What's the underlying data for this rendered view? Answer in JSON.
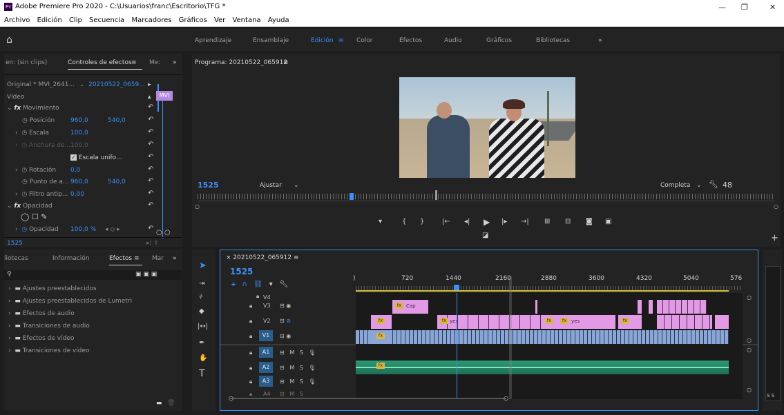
{
  "window": {
    "title": "Adobe Premiere Pro 2020 - C:\\Usuarios\\franc\\Escritorio\\TFG *",
    "app_icon": "Pr"
  },
  "menu": [
    "Archivo",
    "Edición",
    "Clip",
    "Secuencia",
    "Marcadores",
    "Gráficos",
    "Ver",
    "Ventana",
    "Ayuda"
  ],
  "workspaces": {
    "items": [
      "Aprendizaje",
      "Ensamblaje",
      "Edición",
      "Color",
      "Efectos",
      "Audio",
      "Gráficos",
      "Bibliotecas"
    ],
    "active": "Edición",
    "more": "»"
  },
  "effects_panel": {
    "tabs": [
      "en: (sin clips)",
      "Controles de efectos",
      "Me:"
    ],
    "source": "Original * MVI_2641...",
    "sequence": "20210522_0659...",
    "clip_label": "MVI",
    "section_video": "Vídeo",
    "movimiento": "Movimiento",
    "posicion": {
      "label": "Posición",
      "x": "960,0",
      "y": "540,0"
    },
    "escala": {
      "label": "Escala",
      "value": "100,0"
    },
    "anchura": {
      "label": "Anchura de...",
      "value": "100,0"
    },
    "escala_uniforme": "Escala unifo...",
    "rotacion": {
      "label": "Rotación",
      "value": "0,0"
    },
    "punto_anclaje": {
      "label": "Punto de a...",
      "x": "960,0",
      "y": "540,0"
    },
    "filtro": {
      "label": "Filtro antip...",
      "value": "0,00"
    },
    "opacidad_group": "Opacidad",
    "opacidad": {
      "label": "Opacidad",
      "value": "100,0 %"
    },
    "timecode": "1525"
  },
  "program": {
    "title": "Programa: 20210522_065912",
    "timecode": "1525",
    "fit": "Ajustar",
    "quality": "Completa",
    "duration": "48"
  },
  "effects_browser": {
    "tabs": [
      "liotecas",
      "Información",
      "Efectos",
      "Mar"
    ],
    "items": [
      "Ajustes preestablecidos",
      "Ajustes preestablecidos de Lumetri",
      "Efectos de audio",
      "Transiciones de audio",
      "Efectos de vídeo",
      "Transiciones de vídeo"
    ]
  },
  "timeline": {
    "sequence": "20210522_065912",
    "timecode": "1525",
    "ruler": [
      "720",
      "1440",
      "2160",
      "2880",
      "3600",
      "4320",
      "5040",
      "576"
    ],
    "video_tracks": [
      "V4",
      "V3",
      "V2",
      "V1"
    ],
    "audio_tracks": [
      "A1",
      "A2",
      "A3",
      "A4"
    ],
    "clip_labels": {
      "cap": "Cap",
      "yes1": "yes",
      "yes2": "yes"
    },
    "audio_m": "M",
    "audio_s": "S"
  },
  "meters": {
    "label": "S S"
  }
}
